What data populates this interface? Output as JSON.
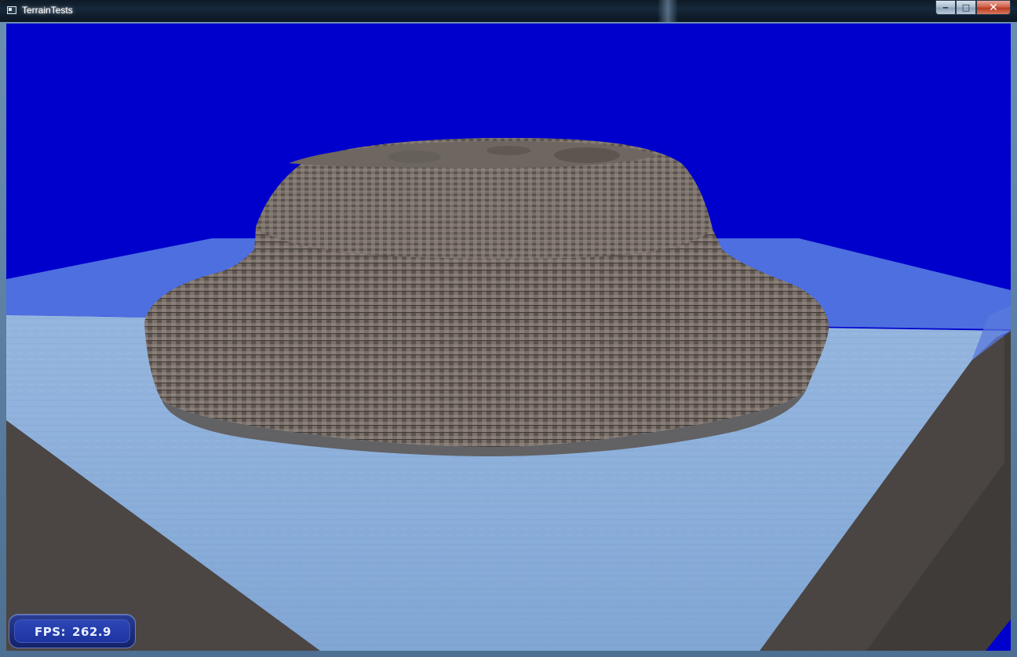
{
  "window": {
    "title": "TerrainTests",
    "icon": "app-window-icon",
    "controls": [
      {
        "name": "minimize-button",
        "glyph": "‒",
        "icon": "minimize-icon"
      },
      {
        "name": "maximize-button",
        "glyph": "□",
        "icon": "maximize-icon"
      },
      {
        "name": "close-button",
        "glyph": "✕",
        "icon": "close-icon"
      }
    ]
  },
  "scene": {
    "sky_color": "#0000cc",
    "water_color": "#8fb2dc",
    "terrain_color": "#7a7069",
    "cliff_color": "#4b4644"
  },
  "hud": {
    "fps_label": "FPS:",
    "fps_value": "262.9"
  }
}
